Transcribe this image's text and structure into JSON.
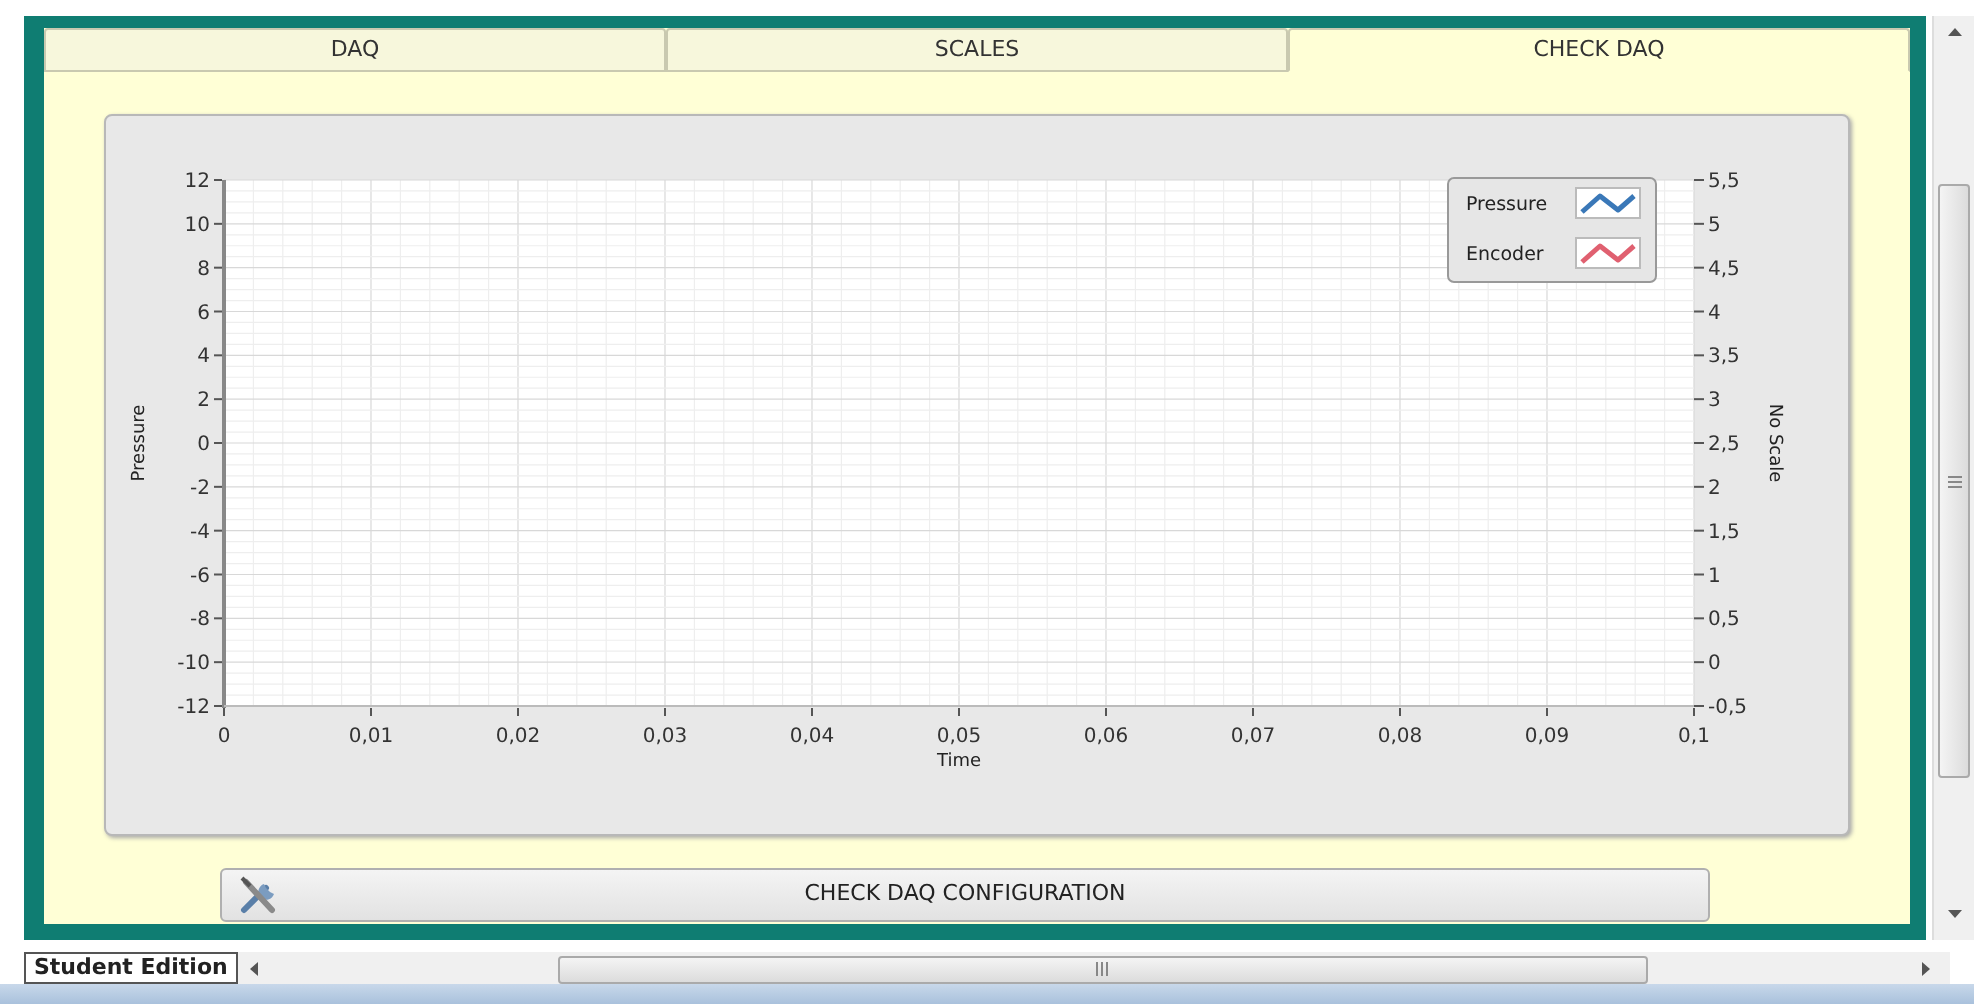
{
  "tabs": [
    {
      "label": "DAQ",
      "selected": false
    },
    {
      "label": "SCALES",
      "selected": false
    },
    {
      "label": "CHECK DAQ",
      "selected": true
    }
  ],
  "graph": {
    "chart_data": {
      "type": "line",
      "xlabel": "Time",
      "ylabel": "Pressure",
      "y2label": "No Scale",
      "series": [
        {
          "name": "Pressure",
          "color": "#3a78b8",
          "values": [
            null,
            null,
            null,
            null,
            null,
            null,
            null,
            null,
            null,
            null,
            null
          ]
        },
        {
          "name": "Encoder",
          "color": "#e06070",
          "values": [
            null,
            null,
            null,
            null,
            null,
            null,
            null,
            null,
            null,
            null,
            null
          ]
        }
      ],
      "ylim": [
        -12,
        12
      ],
      "y2lim": [
        -0.5,
        5.5
      ],
      "grid": true,
      "categories": [
        "0",
        "0,01",
        "0,02",
        "0,03",
        "0,04",
        "0,05",
        "0,06",
        "0,07",
        "0,08",
        "0,09",
        "0,1"
      ],
      "yticks": [
        12,
        10,
        8,
        6,
        4,
        2,
        0,
        -2,
        -4,
        -6,
        -8,
        -10,
        -12
      ],
      "y2ticks": [
        {
          "value": 5.5,
          "label": "5,5"
        },
        5,
        {
          "value": 4.5,
          "label": "4,5"
        },
        4,
        {
          "value": 3.5,
          "label": "3,5"
        },
        3,
        {
          "value": 2.5,
          "label": "2,5"
        },
        2,
        {
          "value": 1.5,
          "label": "1,5"
        },
        1,
        {
          "value": 0.5,
          "label": "0,5"
        },
        0,
        {
          "value": -0.5,
          "label": "-0,5"
        }
      ]
    }
  },
  "button": {
    "label": "CHECK DAQ CONFIGURATION"
  },
  "status_label": "Student Edition"
}
